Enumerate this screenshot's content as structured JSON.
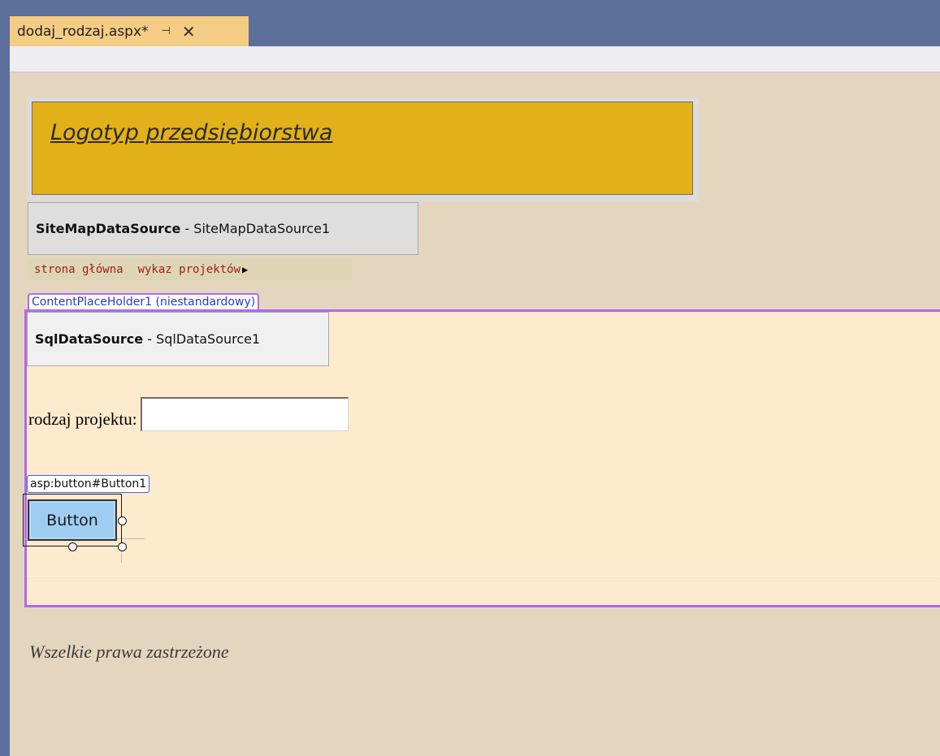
{
  "tab": {
    "title": "dodaj_rodzaj.aspx*",
    "pin_glyph": "⊣",
    "close_glyph": "✕",
    "icons": [
      "pin-icon",
      "close-icon"
    ]
  },
  "logo": {
    "text": "Logotyp przedsiębiorstwa"
  },
  "sitemap_datasource": {
    "type": "SiteMapDataSource",
    "separator": " - ",
    "id": "SiteMapDataSource1"
  },
  "breadcrumb": {
    "items": [
      "strona główna",
      "wykaz projektów"
    ],
    "arrow_glyph": "▶"
  },
  "content_placeholder": {
    "label": "ContentPlaceHolder1 (niestandardowy)"
  },
  "sql_datasource": {
    "type": "SqlDataSource",
    "separator": " - ",
    "id": "SqlDataSource1"
  },
  "form": {
    "field_label": "rodzaj projektu:",
    "field_value": ""
  },
  "button": {
    "tag_label": "asp:button#Button1",
    "text": "Button"
  },
  "footer": {
    "text": "Wszelkie prawa zastrzeżone"
  },
  "colors": {
    "tab_bg": "#f5cc84",
    "editor_bg": "#e4d6be",
    "logo_bg": "#e2b018",
    "placeholder_border": "#b367f2",
    "placeholder_bg": "#feeacc",
    "button_bg": "#9fcdf2",
    "breadcrumb_link": "#a31c1c"
  }
}
